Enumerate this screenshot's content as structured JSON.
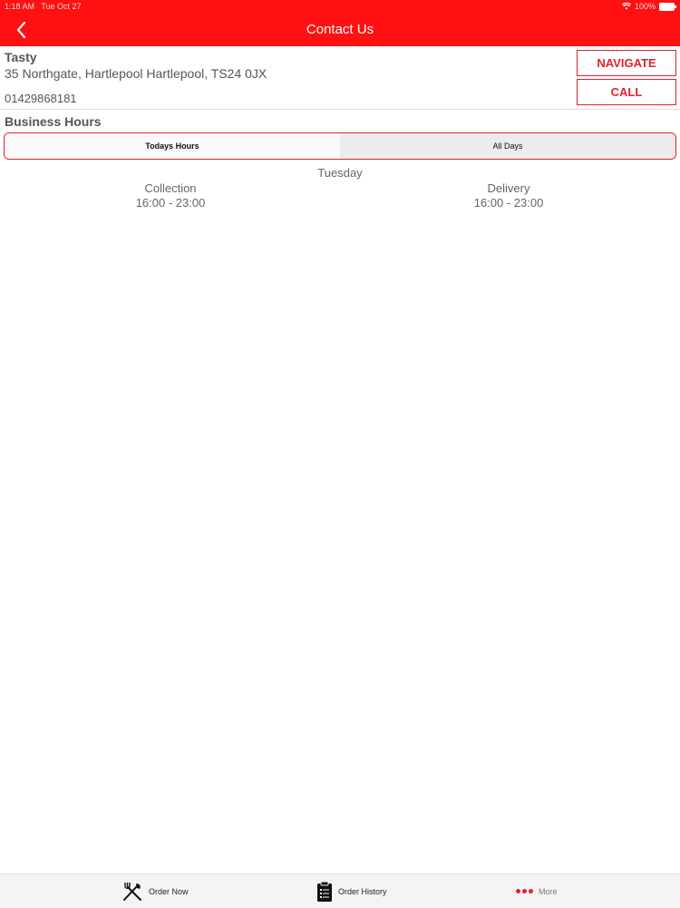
{
  "status": {
    "time": "1:18 AM",
    "date": "Tue Oct 27",
    "battery": "100%"
  },
  "header": {
    "title": "Contact Us"
  },
  "store": {
    "name": "Tasty",
    "address": "35 Northgate, Hartlepool Hartlepool, TS24 0JX",
    "phone": "01429868181"
  },
  "actions": {
    "navigate_label": "NAVIGATE",
    "call_label": "CALL"
  },
  "business_hours": {
    "title": "Business Hours",
    "tabs": [
      {
        "label": "Todays Hours",
        "active": true
      },
      {
        "label": "All Days",
        "active": false
      }
    ],
    "day": "Tuesday",
    "collection": {
      "label": "Collection",
      "hours": "16:00 - 23:00"
    },
    "delivery": {
      "label": "Delivery",
      "hours": "16:00 - 23:00"
    }
  },
  "tabbar": {
    "items": [
      {
        "label": "Order Now",
        "icon": "fork-knife-icon"
      },
      {
        "label": "Order History",
        "icon": "clipboard-icon"
      },
      {
        "label": "More",
        "icon": "more-dots-icon"
      }
    ]
  },
  "colors": {
    "brand_red": "#ff1111",
    "accent_red": "#e2212b",
    "more_label": "#7a7a7a"
  }
}
